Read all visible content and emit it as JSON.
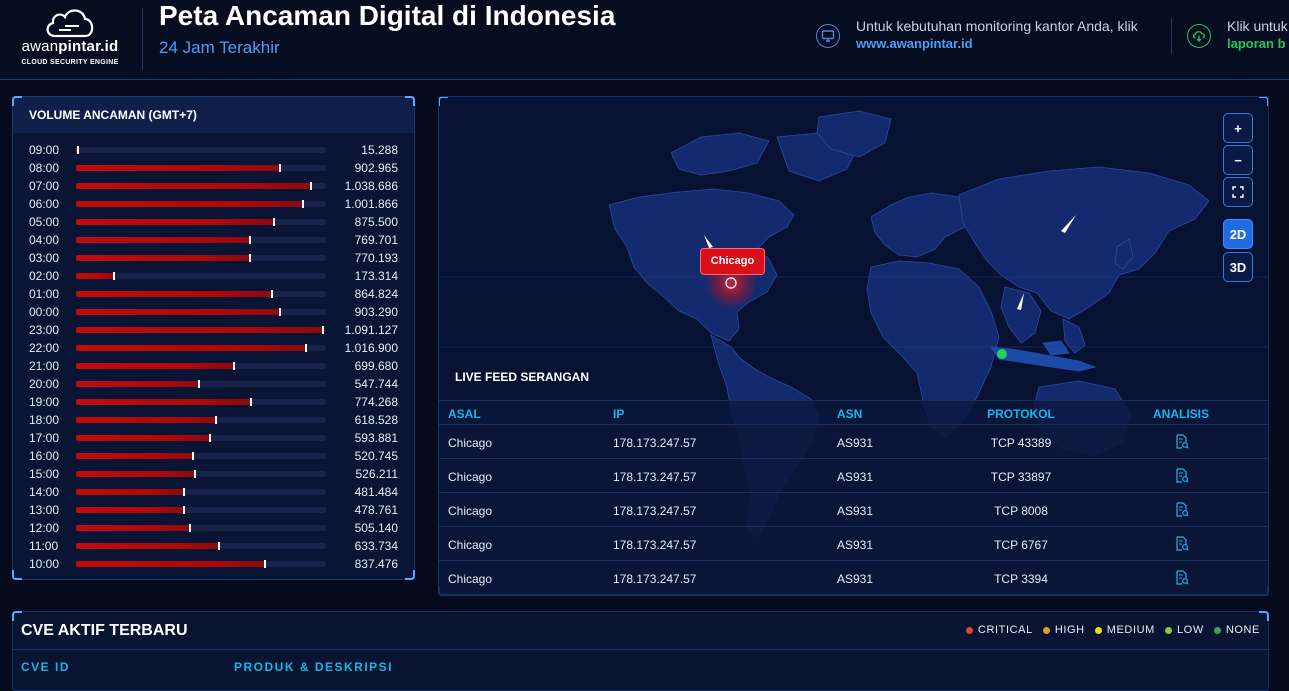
{
  "header": {
    "logo": {
      "brand_light": "awan",
      "brand_bold": "pintar.id",
      "tagline": "CLOUD SECURITY ENGINE"
    },
    "title": "Peta Ancaman Digital di Indonesia",
    "subtitle": "24 Jam Terakhir",
    "promo_monitoring": {
      "text": "Untuk kebutuhan monitoring kantor Anda, klik",
      "link": "www.awanpintar.id",
      "icon": "monitor-icon"
    },
    "promo_report": {
      "text": "Klik untuk",
      "link": "laporan b",
      "icon": "download-icon"
    }
  },
  "volume": {
    "title": "VOLUME ANCAMAN (GMT+7)",
    "max": 1100000,
    "rows": [
      {
        "hour": "09:00",
        "label": "15.288",
        "value": 15288
      },
      {
        "hour": "08:00",
        "label": "902.965",
        "value": 902965
      },
      {
        "hour": "07:00",
        "label": "1.038.686",
        "value": 1038686
      },
      {
        "hour": "06:00",
        "label": "1.001.866",
        "value": 1001866
      },
      {
        "hour": "05:00",
        "label": "875.500",
        "value": 875500
      },
      {
        "hour": "04:00",
        "label": "769.701",
        "value": 769701
      },
      {
        "hour": "03:00",
        "label": "770.193",
        "value": 770193
      },
      {
        "hour": "02:00",
        "label": "173.314",
        "value": 173314
      },
      {
        "hour": "01:00",
        "label": "864.824",
        "value": 864824
      },
      {
        "hour": "00:00",
        "label": "903.290",
        "value": 903290
      },
      {
        "hour": "23:00",
        "label": "1.091.127",
        "value": 1091127
      },
      {
        "hour": "22:00",
        "label": "1.016.900",
        "value": 1016900
      },
      {
        "hour": "21:00",
        "label": "699.680",
        "value": 699680
      },
      {
        "hour": "20:00",
        "label": "547.744",
        "value": 547744
      },
      {
        "hour": "19:00",
        "label": "774.268",
        "value": 774268
      },
      {
        "hour": "18:00",
        "label": "618.528",
        "value": 618528
      },
      {
        "hour": "17:00",
        "label": "593.881",
        "value": 593881
      },
      {
        "hour": "16:00",
        "label": "520.745",
        "value": 520745
      },
      {
        "hour": "15:00",
        "label": "526.211",
        "value": 526211
      },
      {
        "hour": "14:00",
        "label": "481.484",
        "value": 481484
      },
      {
        "hour": "13:00",
        "label": "478.761",
        "value": 478761
      },
      {
        "hour": "12:00",
        "label": "505.140",
        "value": 505140
      },
      {
        "hour": "11:00",
        "label": "633.734",
        "value": 633734
      },
      {
        "hour": "10:00",
        "label": "837.476",
        "value": 837476
      }
    ]
  },
  "map": {
    "controls": {
      "zoom_in": "+",
      "zoom_out": "−",
      "fullscreen": "fullscreen-icon",
      "mode_2d": "2D",
      "mode_3d": "3D"
    },
    "active_mode": "2D",
    "attack_label": "Chicago"
  },
  "feed": {
    "title": "LIVE FEED SERANGAN",
    "columns": {
      "asal": "ASAL",
      "ip": "IP",
      "asn": "ASN",
      "protokol": "PROTOKOL",
      "analisis": "ANALISIS"
    },
    "rows": [
      {
        "asal": "Chicago",
        "ip": "178.173.247.57",
        "asn": "AS931",
        "protokol": "TCP 43389"
      },
      {
        "asal": "Chicago",
        "ip": "178.173.247.57",
        "asn": "AS931",
        "protokol": "TCP 33897"
      },
      {
        "asal": "Chicago",
        "ip": "178.173.247.57",
        "asn": "AS931",
        "protokol": "TCP 8008"
      },
      {
        "asal": "Chicago",
        "ip": "178.173.247.57",
        "asn": "AS931",
        "protokol": "TCP 6767"
      },
      {
        "asal": "Chicago",
        "ip": "178.173.247.57",
        "asn": "AS931",
        "protokol": "TCP 3394"
      }
    ]
  },
  "cve": {
    "title": "CVE AKTIF TERBARU",
    "legend": [
      {
        "label": "CRITICAL",
        "color": "#e0452f"
      },
      {
        "label": "HIGH",
        "color": "#e89a1c"
      },
      {
        "label": "MEDIUM",
        "color": "#e6e01c"
      },
      {
        "label": "LOW",
        "color": "#8cc63f"
      },
      {
        "label": "NONE",
        "color": "#3fa34d"
      }
    ],
    "columns": {
      "id": "CVE ID",
      "produk": "PRODUK & DESKRIPSI"
    }
  },
  "colors": {
    "accent": "#4f9df5",
    "threat": "#d9101a",
    "panel": "#0a1535",
    "link_green": "#22c55e",
    "table_header": "#18b6e8"
  }
}
